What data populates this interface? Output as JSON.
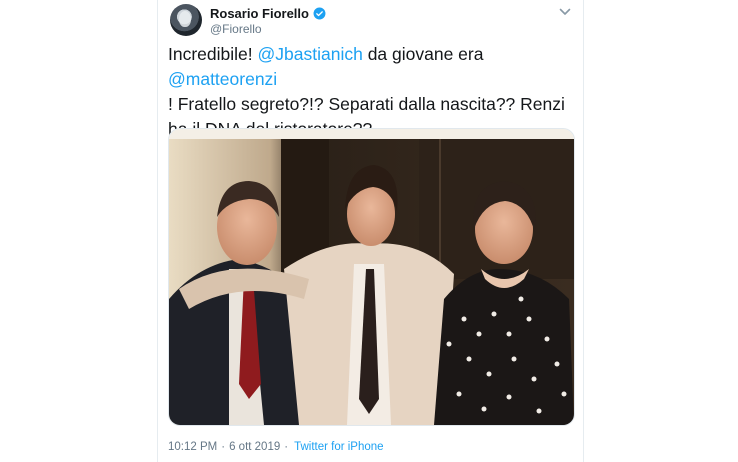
{
  "tweet": {
    "display_name": "Rosario Fiorello",
    "handle": "@Fiorello",
    "text": {
      "line1_a": "Incredibile! ",
      "mention1": "@Jbastianich",
      "line1_b": " da giovane era ",
      "mention2": "@matteorenzi",
      "line2": " ! Fratello segreto?!? Separati dalla nascita?? Renzi ha il DNA del ristoratore??"
    },
    "time": "10:12 PM",
    "date": "6 ott 2019",
    "separator": "·",
    "source": "Twitter for iPhone"
  },
  "colors": {
    "link": "#1da1f2",
    "text": "#14171a",
    "muted": "#657786",
    "verified": "#1da1f2"
  },
  "icons": [
    "verified-badge-icon",
    "chevron-down-icon"
  ]
}
